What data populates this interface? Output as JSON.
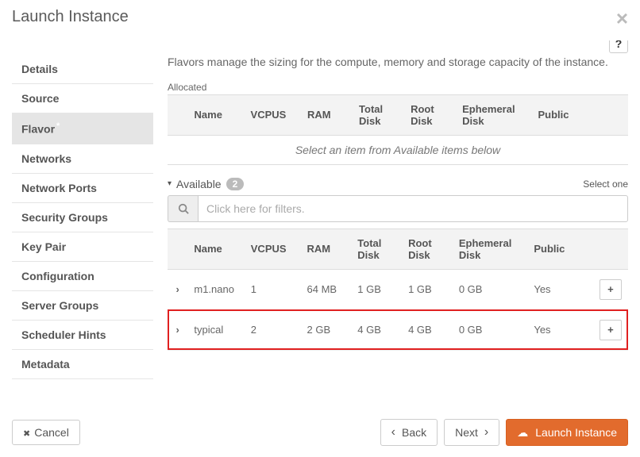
{
  "header": {
    "title": "Launch Instance"
  },
  "sidebar": {
    "items": [
      {
        "label": "Details"
      },
      {
        "label": "Source"
      },
      {
        "label": "Flavor"
      },
      {
        "label": "Networks"
      },
      {
        "label": "Network Ports"
      },
      {
        "label": "Security Groups"
      },
      {
        "label": "Key Pair"
      },
      {
        "label": "Configuration"
      },
      {
        "label": "Server Groups"
      },
      {
        "label": "Scheduler Hints"
      },
      {
        "label": "Metadata"
      }
    ]
  },
  "content": {
    "description": "Flavors manage the sizing for the compute, memory and storage capacity of the instance.",
    "allocated_label": "Allocated",
    "available_label": "Available",
    "available_count": "2",
    "select_one": "Select one",
    "empty_allocated": "Select an item from Available items below",
    "filter_placeholder": "Click here for filters.",
    "columns": {
      "name": "Name",
      "vcpus": "VCPUS",
      "ram": "RAM",
      "total_disk": "Total Disk",
      "root_disk": "Root Disk",
      "ephemeral_disk": "Ephemeral Disk",
      "public": "Public"
    },
    "available_rows": [
      {
        "name": "m1.nano",
        "vcpus": "1",
        "ram": "64 MB",
        "total_disk": "1 GB",
        "root_disk": "1 GB",
        "ephemeral_disk": "0 GB",
        "public": "Yes"
      },
      {
        "name": "typical",
        "vcpus": "2",
        "ram": "2 GB",
        "total_disk": "4 GB",
        "root_disk": "4 GB",
        "ephemeral_disk": "0 GB",
        "public": "Yes"
      }
    ]
  },
  "footer": {
    "cancel": "Cancel",
    "back": "Back",
    "next": "Next",
    "launch": "Launch Instance"
  }
}
